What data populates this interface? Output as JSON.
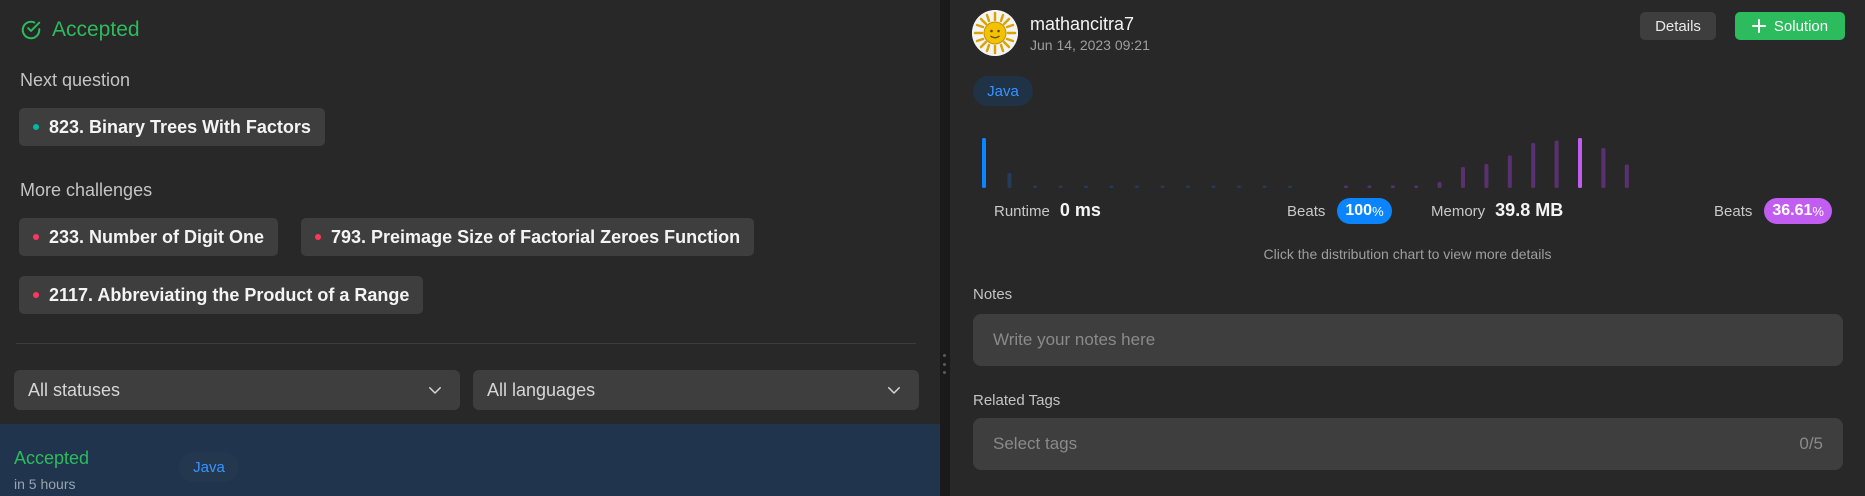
{
  "left": {
    "status": "Accepted",
    "next_label": "Next question",
    "next_question": "823. Binary Trees With Factors",
    "more_label": "More challenges",
    "challenges": [
      "233. Number of Digit One",
      "793. Preimage Size of Factorial Zeroes Function",
      "2117. Abbreviating the Product of a Range"
    ],
    "filters": {
      "status": "All statuses",
      "language": "All languages"
    },
    "submission": {
      "status": "Accepted",
      "time": "in 5 hours",
      "language": "Java"
    }
  },
  "right": {
    "username": "mathancitra7",
    "date": "Jun 14, 2023 09:21",
    "details_label": "Details",
    "solution_label": "Solution",
    "language": "Java",
    "runtime": {
      "label": "Runtime",
      "value": "0 ms",
      "beats_label": "Beats",
      "beats_value": "100",
      "beats_unit": "%"
    },
    "memory": {
      "label": "Memory",
      "value": "39.8 MB",
      "beats_label": "Beats",
      "beats_value": "36.61",
      "beats_unit": "%"
    },
    "hint": "Click the distribution chart to view more details",
    "notes_label": "Notes",
    "notes_placeholder": "Write your notes here",
    "tags_label": "Related Tags",
    "tags_placeholder": "Select tags",
    "tags_count": "0/5"
  },
  "colors": {
    "accepted": "#2cbb5d",
    "medium": "#00b8a3",
    "hard": "#ff375f",
    "runtime_accent": "#0a84ff",
    "memory_accent": "#c15ef1"
  },
  "chart_data": {
    "type": "bar",
    "series": [
      {
        "values": [
          1.0,
          0.3,
          0.05,
          0.05,
          0.05,
          0.05,
          0.05,
          0.05,
          0.05,
          0.05,
          0.05,
          0.05,
          0.05
        ],
        "highlight": 0
      },
      {
        "values": [
          0.05,
          0.05,
          0.05,
          0.05,
          0.12,
          0.42,
          0.48,
          0.65,
          0.9,
          0.95,
          1.0,
          0.8,
          0.47
        ],
        "highlight": 10
      }
    ]
  }
}
